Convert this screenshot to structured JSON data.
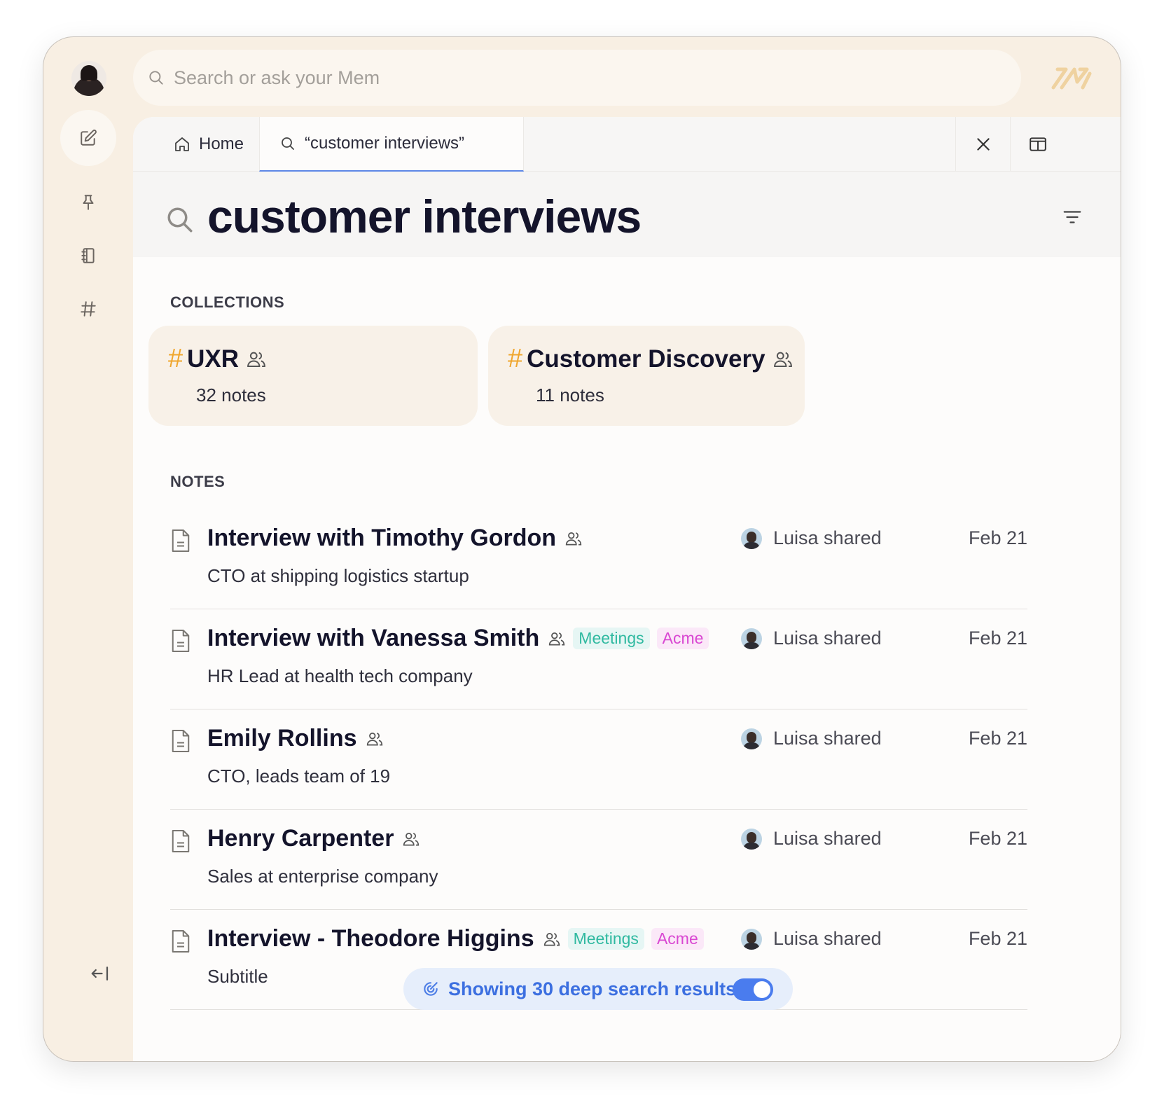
{
  "search": {
    "placeholder": "Search or ask your Mem"
  },
  "tabs": [
    {
      "label": "Home",
      "icon": "home-icon"
    },
    {
      "label": "“customer interviews”",
      "icon": "search-icon"
    }
  ],
  "header": {
    "title": "customer interviews"
  },
  "sections": {
    "collections": "COLLECTIONS",
    "notes": "NOTES"
  },
  "collections": [
    {
      "hash": "#",
      "name": "UXR",
      "count": "32 notes"
    },
    {
      "hash": "#",
      "name": "Customer Discovery",
      "count": "11 notes"
    }
  ],
  "notes": [
    {
      "title": "Interview with Timothy Gordon",
      "subtitle": "CTO at shipping logistics startup",
      "tags": [],
      "shared": "Luisa shared",
      "date": "Feb 21"
    },
    {
      "title": "Interview with Vanessa Smith",
      "subtitle": "HR Lead at health tech company",
      "tags": [
        "Meetings",
        "Acme"
      ],
      "shared": "Luisa shared",
      "date": "Feb 21"
    },
    {
      "title": "Emily Rollins",
      "subtitle": "CTO, leads team of 19",
      "tags": [],
      "shared": "Luisa shared",
      "date": "Feb 21"
    },
    {
      "title": "Henry Carpenter",
      "subtitle": "Sales at enterprise company",
      "tags": [],
      "shared": "Luisa shared",
      "date": "Feb 21"
    },
    {
      "title": "Interview - Theodore Higgins",
      "subtitle": "Subtitle",
      "tags": [
        "Meetings",
        "Acme"
      ],
      "shared": "Luisa shared",
      "date": "Feb 21"
    }
  ],
  "toast": {
    "label": "Showing 30 deep search results",
    "toggle_on": true
  },
  "colors": {
    "accent": "#4a7cee",
    "hash": "#f0a62d",
    "meetings": "#2fb9a0",
    "acme": "#d947d2",
    "rail": "#f8efe3"
  }
}
